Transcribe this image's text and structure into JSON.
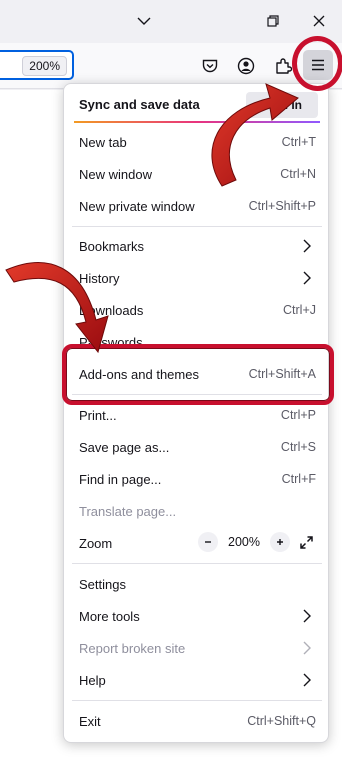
{
  "titlebar": {
    "minimize_icon": "chevron-down-icon",
    "restore_icon": "restore-icon",
    "close_icon": "close-icon"
  },
  "toolbar": {
    "zoom_level": "200%",
    "icons": [
      "pocket-icon",
      "account-icon",
      "extensions-icon",
      "hamburger-menu-icon"
    ]
  },
  "menu": {
    "sync": {
      "label": "Sync and save data",
      "button": "Sign In"
    },
    "items": [
      {
        "label": "New tab",
        "shortcut": "Ctrl+T"
      },
      {
        "label": "New window",
        "shortcut": "Ctrl+N"
      },
      {
        "label": "New private window",
        "shortcut": "Ctrl+Shift+P"
      },
      {
        "label": "Bookmarks"
      },
      {
        "label": "History"
      },
      {
        "label": "Downloads",
        "shortcut": "Ctrl+J"
      },
      {
        "label": "Passwords"
      },
      {
        "label": "Add-ons and themes",
        "shortcut": "Ctrl+Shift+A"
      },
      {
        "label": "Print...",
        "shortcut": "Ctrl+P"
      },
      {
        "label": "Save page as...",
        "shortcut": "Ctrl+S"
      },
      {
        "label": "Find in page...",
        "shortcut": "Ctrl+F"
      },
      {
        "label": "Translate page..."
      },
      {
        "label": "Zoom",
        "value": "200%"
      },
      {
        "label": "Settings"
      },
      {
        "label": "More tools"
      },
      {
        "label": "Report broken site"
      },
      {
        "label": "Help"
      },
      {
        "label": "Exit",
        "shortcut": "Ctrl+Shift+Q"
      }
    ]
  },
  "colors": {
    "highlight": "#c8102e",
    "focus_ring": "#0060df"
  }
}
